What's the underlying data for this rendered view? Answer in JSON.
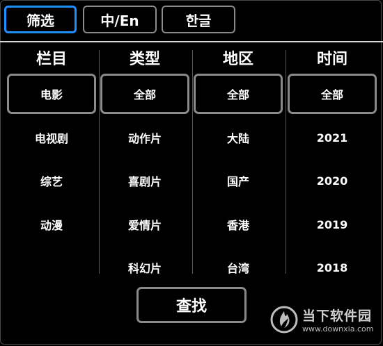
{
  "tabs": [
    {
      "label": "筛选",
      "active": true
    },
    {
      "label": "中/En",
      "active": false
    },
    {
      "label": "한글",
      "active": false
    }
  ],
  "columns": [
    {
      "header": "栏目",
      "options": [
        "电影",
        "电视剧",
        "综艺",
        "动漫"
      ],
      "selected": "电影"
    },
    {
      "header": "类型",
      "options": [
        "全部",
        "动作片",
        "喜剧片",
        "爱情片",
        "科幻片"
      ],
      "selected": "全部"
    },
    {
      "header": "地区",
      "options": [
        "全部",
        "大陆",
        "国产",
        "香港",
        "台湾"
      ],
      "selected": "全部"
    },
    {
      "header": "时间",
      "options": [
        "全部",
        "2021",
        "2020",
        "2019",
        "2018"
      ],
      "selected": "全部"
    }
  ],
  "search_button": {
    "label": "查找"
  },
  "watermark": {
    "title": "当下软件园",
    "url": "www.downxia.com",
    "icon": "downxia-logo-icon"
  },
  "colors": {
    "accent": "#1e90ff",
    "border": "#8a8a8a",
    "background": "#000000"
  }
}
